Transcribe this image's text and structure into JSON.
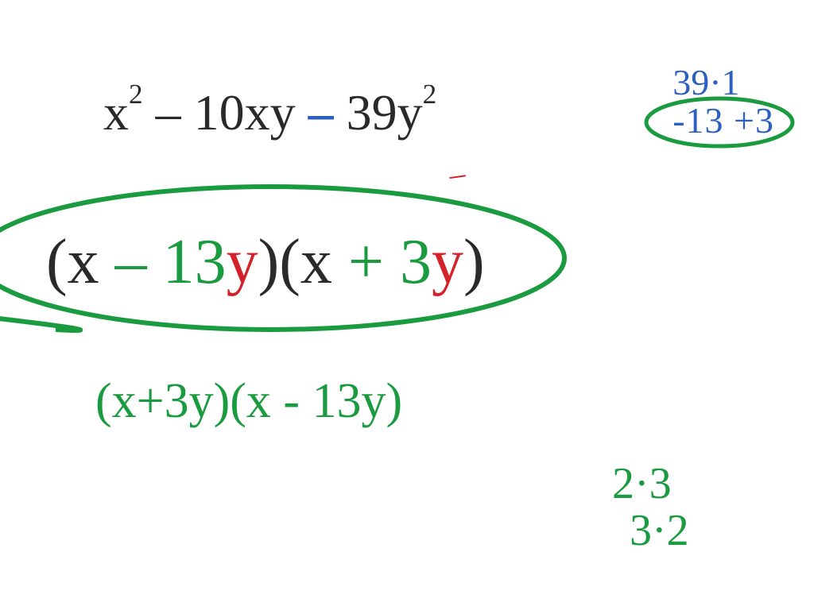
{
  "problem": {
    "t1": "x",
    "e1": "2",
    "m1": "– 10xy",
    "m2": "– ",
    "t2": "39y",
    "e2": "2"
  },
  "factor_pairs": {
    "row1": "39·1",
    "row2": "-13 +3"
  },
  "answer": {
    "p1": "(x ",
    "p2": "– 13",
    "p3": "y",
    "p4": ")(x ",
    "p5": "+ 3",
    "p6": "y",
    "p7": ")"
  },
  "rewrite": "(x+3y)(x - 13y)",
  "corner": {
    "a": "2·3",
    "b": "3·2"
  }
}
